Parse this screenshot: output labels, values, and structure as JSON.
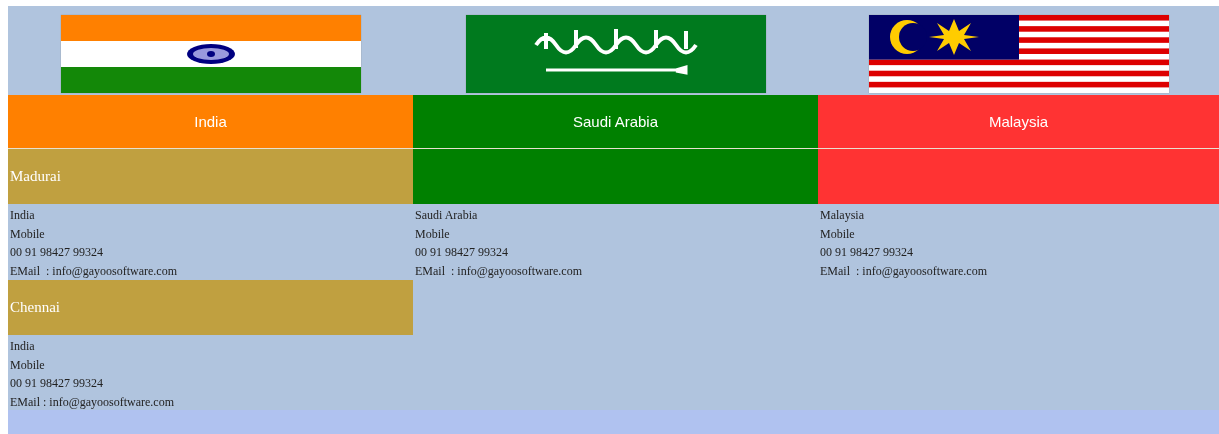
{
  "columns": [
    {
      "country": "India",
      "color": "#ff8000",
      "offices": [
        {
          "city": "Madurai",
          "color": "#c0a040",
          "lines": [
            "India",
            "Mobile",
            "00 91 98427 99324",
            "EMail  : info@gayoosoftware.com"
          ]
        },
        {
          "city": "Chennai",
          "color": "#c0a040",
          "lines": [
            "India",
            "Mobile",
            "00 91 98427 99324",
            "EMail : info@gayoosoftware.com"
          ]
        }
      ]
    },
    {
      "country": "Saudi Arabia",
      "color": "#008000",
      "offices": [
        {
          "color": "#008000",
          "lines": [
            "Saudi Arabia",
            "Mobile",
            "00 91 98427 99324",
            "EMail  : info@gayoosoftware.com"
          ]
        }
      ]
    },
    {
      "country": "Malaysia",
      "color": "#ff3333",
      "offices": [
        {
          "color": "#ff3333",
          "lines": [
            "Malaysia",
            "Mobile",
            "00 91 98427 99324",
            "EMail  : info@gayoosoftware.com"
          ]
        }
      ]
    }
  ]
}
